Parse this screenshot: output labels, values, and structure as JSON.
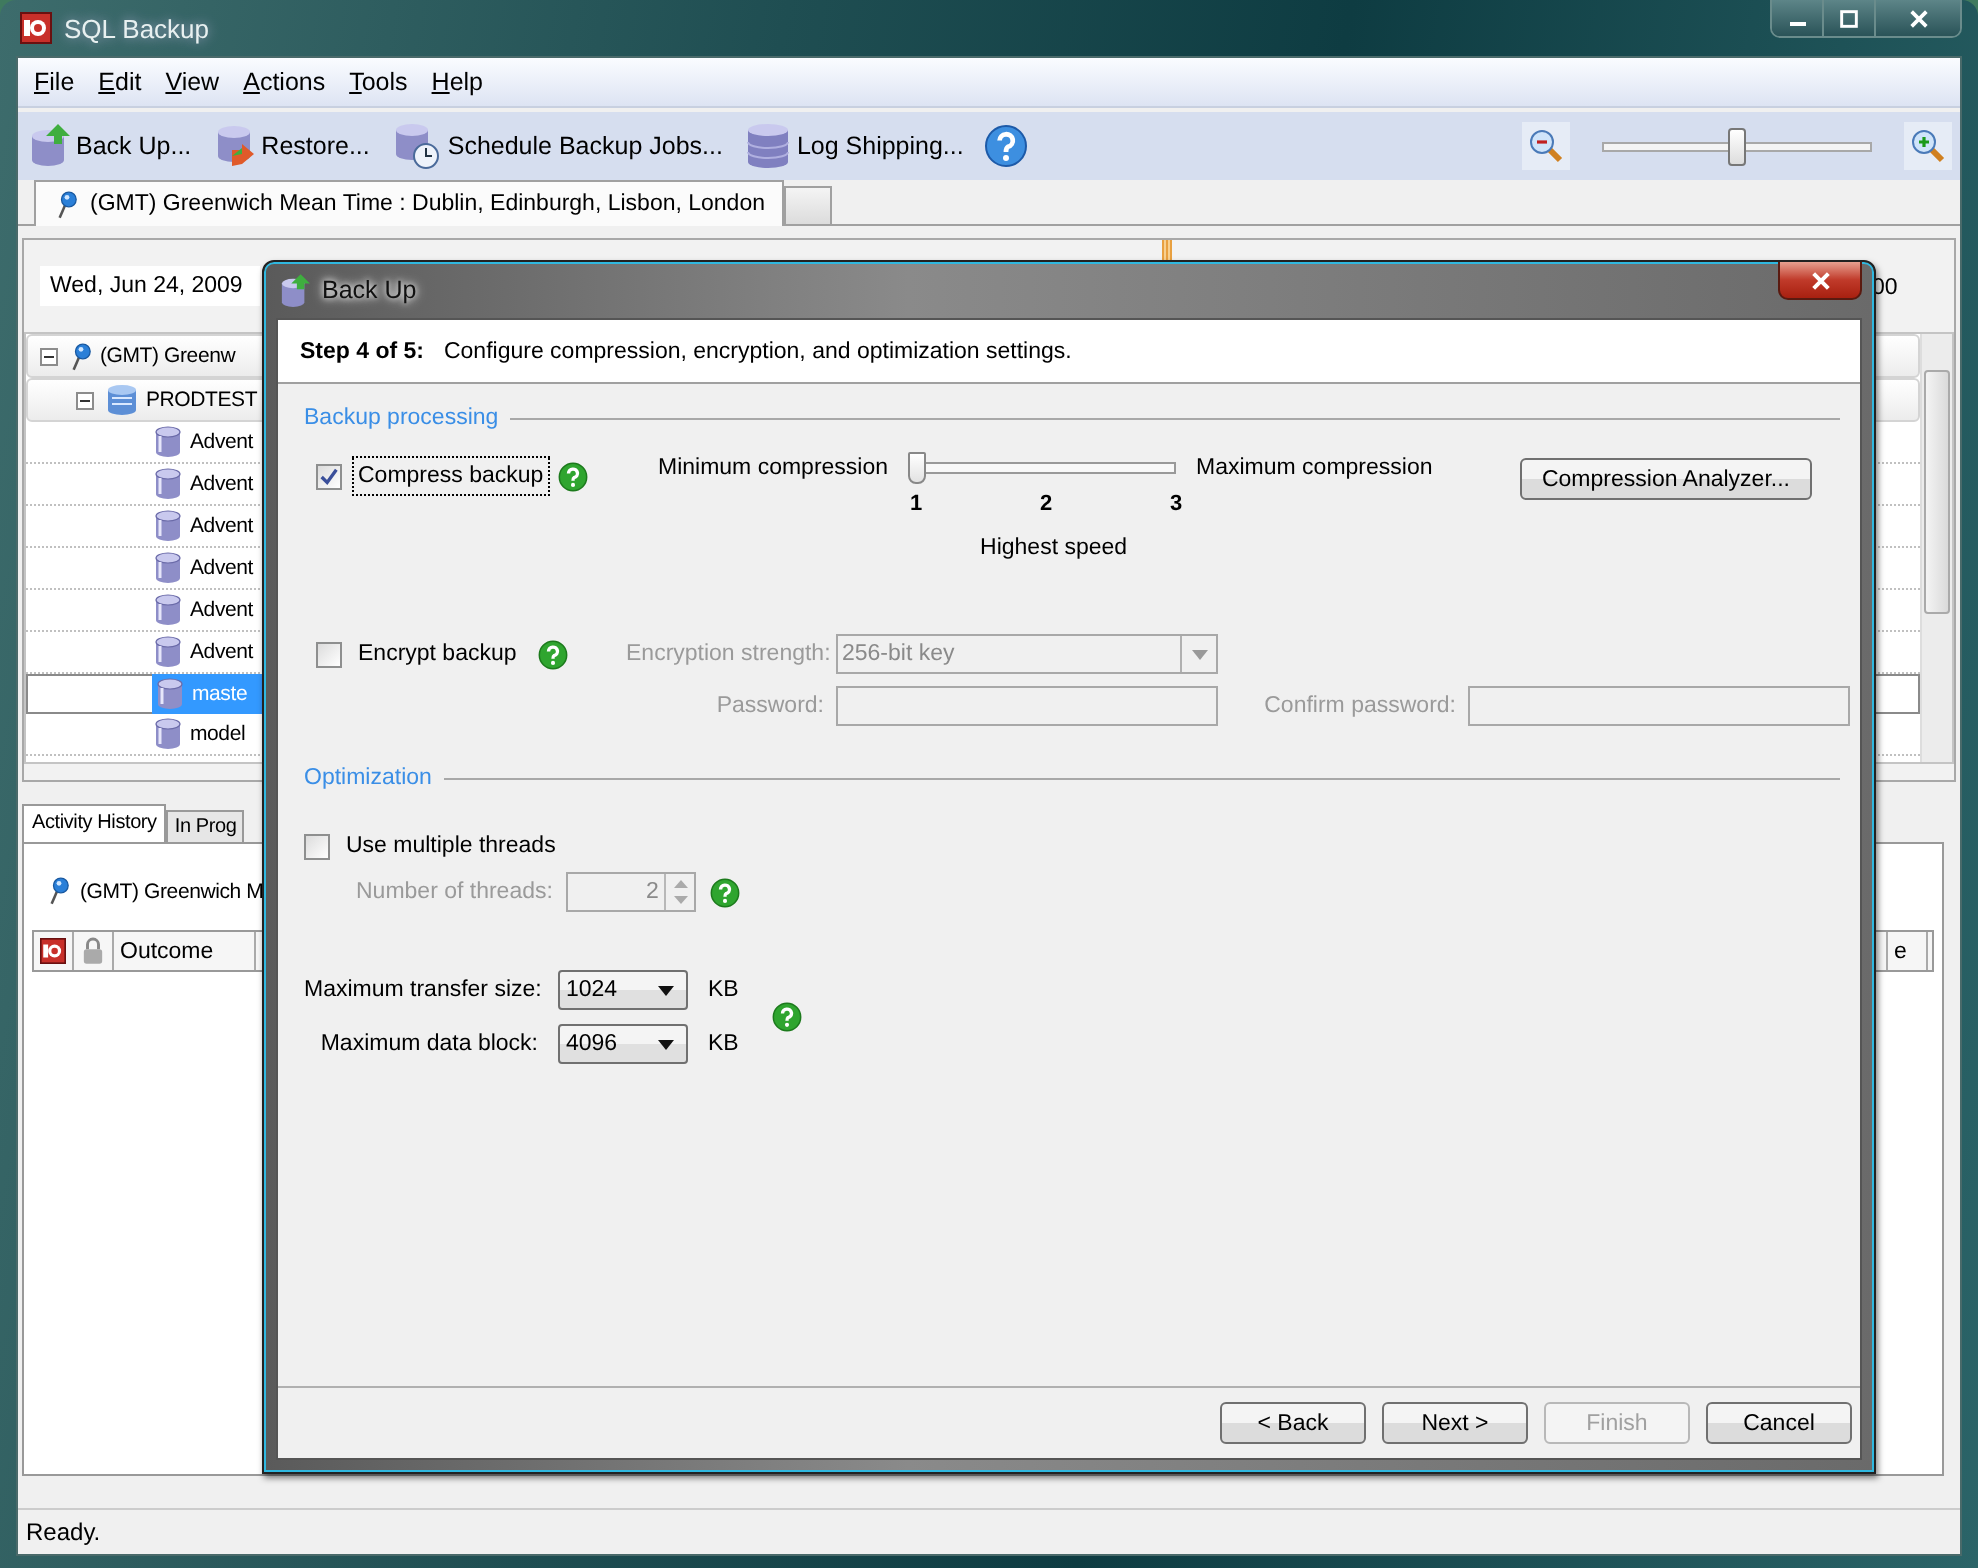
{
  "window": {
    "title": "SQL Backup"
  },
  "menu": [
    "File",
    "Edit",
    "View",
    "Actions",
    "Tools",
    "Help"
  ],
  "toolbar": [
    {
      "kind": "backup",
      "label": "Back Up..."
    },
    {
      "kind": "restore",
      "label": "Restore..."
    },
    {
      "kind": "schedule",
      "label": "Schedule Backup Jobs..."
    },
    {
      "kind": "log",
      "label": "Log Shipping..."
    }
  ],
  "zoom": {
    "level": 0.5
  },
  "timezone_tabs": [
    {
      "label": "(GMT) Greenwich Mean Time : Dublin, Edinburgh, Lisbon, London",
      "selected": true
    }
  ],
  "timeline": {
    "date": "Wed, Jun 24, 2009",
    "hour_label": "00"
  },
  "tree": [
    {
      "kind": "timezone",
      "label": "(GMT) Greenw",
      "expanded": true,
      "selected": false,
      "children": [
        {
          "kind": "server",
          "label": "PRODTEST",
          "expanded": true,
          "selected": false,
          "children": [
            {
              "kind": "database",
              "label": "Advent",
              "selected": false
            },
            {
              "kind": "database",
              "label": "Advent",
              "selected": false
            },
            {
              "kind": "database",
              "label": "Advent",
              "selected": false
            },
            {
              "kind": "database",
              "label": "Advent",
              "selected": false
            },
            {
              "kind": "database",
              "label": "Advent",
              "selected": false
            },
            {
              "kind": "database",
              "label": "Advent",
              "selected": false
            },
            {
              "kind": "database",
              "label": "maste",
              "selected": true
            },
            {
              "kind": "database",
              "label": "model",
              "selected": false
            }
          ]
        }
      ]
    }
  ],
  "bottom_tabs": [
    {
      "label": "Activity History",
      "selected": true
    },
    {
      "label": "In Prog",
      "selected": false
    }
  ],
  "history": {
    "timezone": "(GMT) Greenwich M",
    "columns": [
      {
        "kind": "app-icon"
      },
      {
        "kind": "lock-icon"
      },
      {
        "kind": "text",
        "label": "Outcome"
      }
    ],
    "last_column": "e"
  },
  "status_bar": "Ready.",
  "dialog": {
    "title": "Back Up",
    "step": "Step 4 of 5:",
    "step_description": "Configure compression, encryption, and optimization settings.",
    "backup_processing": {
      "heading": "Backup processing",
      "compress": {
        "label": "Compress backup",
        "checked": true
      },
      "compression": {
        "min_label": "Minimum compression",
        "max_label": "Maximum compression",
        "ticks": [
          "1",
          "2",
          "3"
        ],
        "level": 0,
        "caption": "Highest speed"
      },
      "analyzer_button": "Compression Analyzer...",
      "encrypt": {
        "label": "Encrypt backup",
        "checked": false
      },
      "strength": {
        "label": "Encryption strength:",
        "value": "256-bit key"
      },
      "password": {
        "label": "Password:"
      },
      "confirm_password": {
        "label": "Confirm password:"
      }
    },
    "optimization": {
      "heading": "Optimization",
      "threads": {
        "label": "Use multiple threads",
        "checked": false
      },
      "thread_count": {
        "label": "Number of threads:",
        "value": "2"
      },
      "transfer_size": {
        "label": "Maximum transfer size:",
        "value": "1024",
        "unit": "KB"
      },
      "data_block": {
        "label": "Maximum data block:",
        "value": "4096",
        "unit": "KB"
      }
    },
    "buttons": [
      {
        "label": "< Back",
        "disabled": false
      },
      {
        "label": "Next >",
        "disabled": false
      },
      {
        "label": "Finish",
        "disabled": true
      },
      {
        "label": "Cancel",
        "disabled": false
      }
    ]
  }
}
